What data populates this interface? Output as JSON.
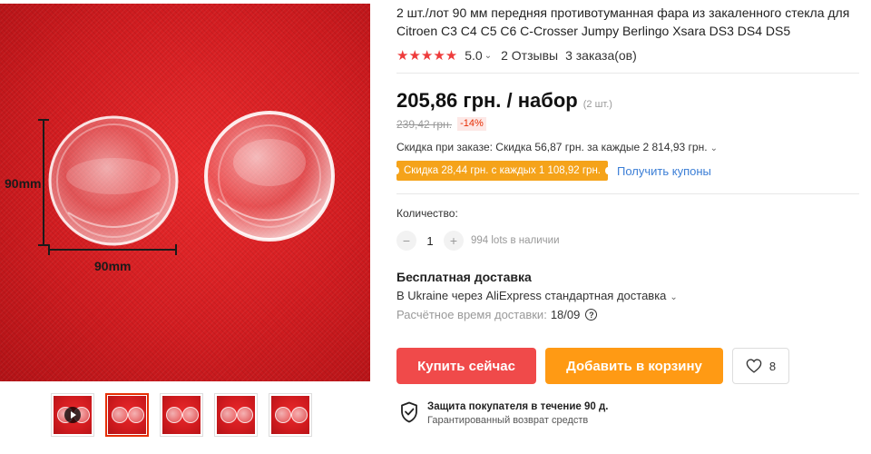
{
  "product": {
    "title": "2 шт./лот 90 мм передняя противотуманная фара из закаленного стекла для Citroen C3 C4 C5 C6 C-Crosser Jumpy Berlingo Xsara DS3 DS4 DS5",
    "rating": "5.0",
    "reviews": "2 Отзывы",
    "orders": "3 заказа(ов)"
  },
  "image": {
    "dim_vertical": "90mm",
    "dim_horizontal": "90mm"
  },
  "price": {
    "current": "205,86 грн. / набор",
    "unit_note": "(2 шт.)",
    "old": "239,42 грн.",
    "discount": "-14%",
    "bulk_discount": "Скидка при заказе: Скидка 56,87 грн. за каждые 2 814,93 грн.",
    "coupon": "Скидка 28,44 грн. с каждых 1 108,92 грн.",
    "coupon_link": "Получить купоны"
  },
  "quantity": {
    "label": "Количество:",
    "value": "1",
    "stock": "994 lots в наличии",
    "minus": "−",
    "plus": "+"
  },
  "shipping": {
    "title": "Бесплатная доставка",
    "method": "В Ukraine через AliExpress стандартная доставка",
    "eta_label": "Расчётное время доставки:",
    "eta_value": "18/09"
  },
  "actions": {
    "buy_now": "Купить сейчас",
    "add_to_cart": "Добавить в корзину",
    "wishlist_count": "8"
  },
  "protection": {
    "title": "Защита покупателя в течение 90 д.",
    "subtitle": "Гарантированный возврат средств"
  },
  "colors": {
    "buy": "#f04a4a",
    "cart": "#ff9a14",
    "coupon": "#f5a31a",
    "link": "#3b7ed6",
    "stars": "#ee3b3b"
  }
}
